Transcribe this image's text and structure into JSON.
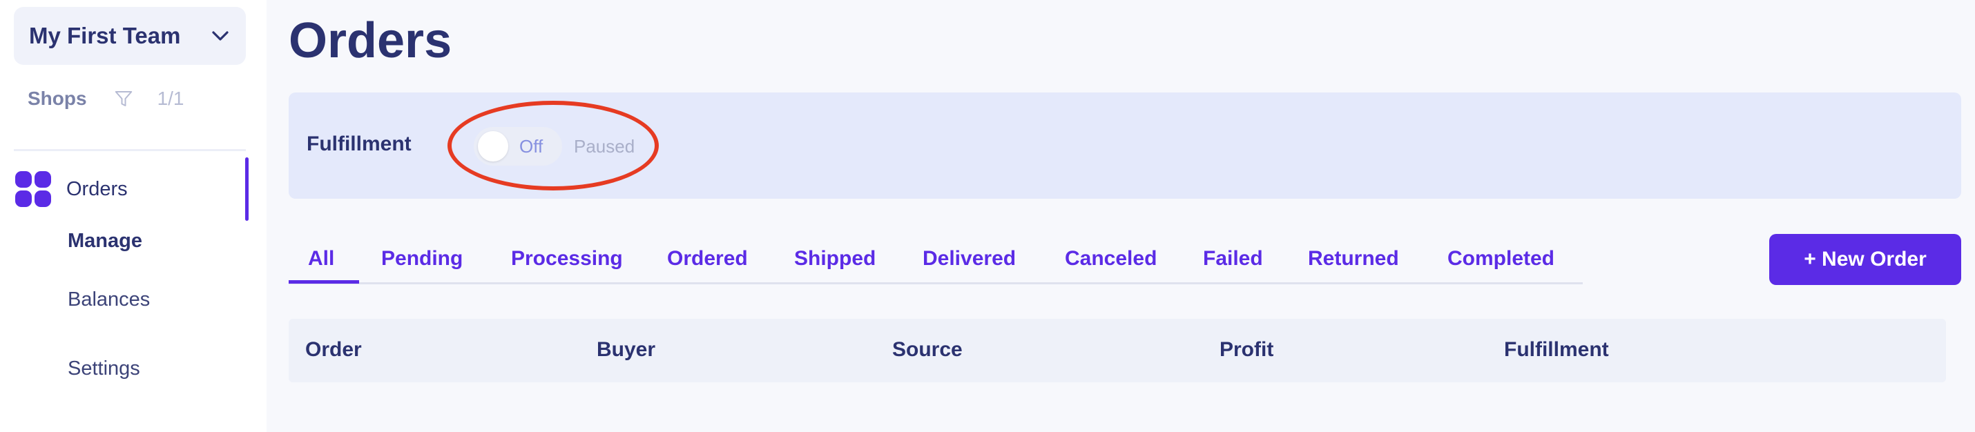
{
  "sidebar": {
    "team_name": "My First Team",
    "shops_label": "Shops",
    "shops_count": "1/1",
    "nav": {
      "orders_label": "Orders",
      "manage_label": "Manage",
      "balances_label": "Balances",
      "settings_label": "Settings"
    }
  },
  "main": {
    "title": "Orders",
    "fulfillment": {
      "label": "Fulfillment",
      "toggle_text": "Off",
      "toggle_on": false,
      "status": "Paused"
    },
    "tabs": [
      {
        "label": "All",
        "active": true
      },
      {
        "label": "Pending"
      },
      {
        "label": "Processing"
      },
      {
        "label": "Ordered"
      },
      {
        "label": "Shipped"
      },
      {
        "label": "Delivered"
      },
      {
        "label": "Canceled"
      },
      {
        "label": "Failed"
      },
      {
        "label": "Returned"
      },
      {
        "label": "Completed"
      }
    ],
    "new_order_label": "+ New Order",
    "table": {
      "columns": [
        "Order",
        "Buyer",
        "Source",
        "Profit",
        "Fulfillment"
      ]
    }
  },
  "colors": {
    "accent": "#5b2be6",
    "text": "#2b3270",
    "highlight": "#e63b22",
    "card_bg": "#e4e9fb"
  },
  "icons": {
    "team_dropdown": "chevron-down-icon",
    "shops_filter": "filter-icon",
    "orders_nav": "grid-icon"
  }
}
